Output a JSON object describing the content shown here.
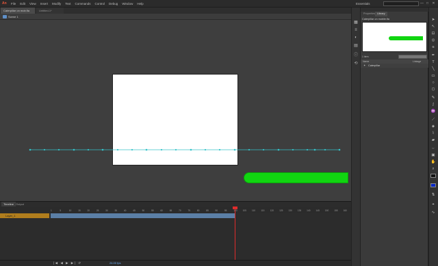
{
  "app": {
    "logo": "An"
  },
  "menu": [
    "File",
    "Edit",
    "View",
    "Insert",
    "Modify",
    "Text",
    "Commands",
    "Control",
    "Debug",
    "Window",
    "Help"
  ],
  "workspace": "Essentials",
  "window_buttons": [
    "—",
    "□",
    "✕"
  ],
  "doc_tabs": [
    {
      "label": "Caterpillar on mob.fla"
    },
    {
      "label": "Untitled-1*"
    }
  ],
  "edit_bar": {
    "scene": "Scene 1"
  },
  "timeline": {
    "tabs": [
      "Timeline",
      "Output"
    ],
    "layer_name": "Layer_1",
    "controls": "|◀ ◀ ▶ ▶| ↺",
    "fps": "24.00 fps",
    "playhead_frame": 100,
    "ruler_marks": [
      "1",
      "5",
      "10",
      "15",
      "20",
      "25",
      "30",
      "35",
      "40",
      "45",
      "50",
      "55",
      "60",
      "65",
      "70",
      "75",
      "80",
      "85",
      "90",
      "95",
      "100",
      "105",
      "110",
      "115",
      "120",
      "125",
      "130",
      "135",
      "140",
      "145",
      "150",
      "155",
      "160"
    ]
  },
  "library": {
    "tabs": [
      "Properties",
      "Library"
    ],
    "document": "Caterpillar on mobile.fla",
    "item_count": "1 item",
    "columns": {
      "name": "Name",
      "linkage": "Linkage"
    },
    "items": [
      {
        "label": "Caterpillar",
        "icon": "movieclip-icon"
      }
    ]
  },
  "colors": {
    "stage": "#ffffff",
    "caterpillar_green": "#11d511",
    "playhead": "#e02c2c",
    "layer_highlight": "#b07d1d",
    "fill_swatch": "#0b2ac9"
  }
}
